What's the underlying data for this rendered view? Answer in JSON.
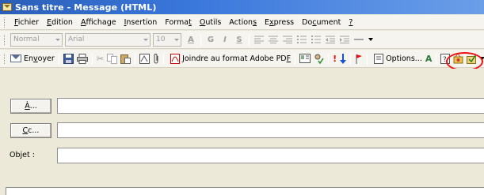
{
  "window": {
    "title": "Sans titre - Message (HTML)",
    "icon": "mail-envelope-icon"
  },
  "menubar": {
    "items": [
      {
        "pre": "",
        "key": "F",
        "post": "ichier"
      },
      {
        "pre": "",
        "key": "E",
        "post": "dition"
      },
      {
        "pre": "",
        "key": "A",
        "post": "ffichage"
      },
      {
        "pre": "",
        "key": "I",
        "post": "nsertion"
      },
      {
        "pre": "Forma",
        "key": "t",
        "post": ""
      },
      {
        "pre": "",
        "key": "O",
        "post": "utils"
      },
      {
        "pre": "Action",
        "key": "s",
        "post": ""
      },
      {
        "pre": "E",
        "key": "x",
        "post": "press"
      },
      {
        "pre": "Do",
        "key": "c",
        "post": "ument"
      },
      {
        "pre": "",
        "key": "?",
        "post": ""
      }
    ]
  },
  "format_toolbar": {
    "style_value": "Normal",
    "font_value": "Arial",
    "size_value": "10",
    "bold_glyph": "G",
    "italic_glyph": "I",
    "underline_glyph": "S"
  },
  "standard_toolbar": {
    "send_pre": "En",
    "send_key": "v",
    "send_post": "oyer",
    "attach_pdf_pre": "Joindre au format Adobe PD",
    "attach_pdf_key": "F",
    "options_pre": "Options",
    "options_key": "",
    "options_post": "...",
    "highlighted_group": [
      "junk-sender-icon",
      "check-names-icon"
    ]
  },
  "fields": {
    "to_label_key": "À",
    "to_label_post": "...",
    "cc_label_key": "C",
    "cc_label_post": "c...",
    "subject_label": "Objet :",
    "to_value": "",
    "cc_value": "",
    "subject_value": ""
  },
  "colors": {
    "title_bar": "#2a5fb8",
    "highlight_circle": "#e11111",
    "importance_high": "#e01010",
    "importance_low": "#1a4fd0"
  }
}
